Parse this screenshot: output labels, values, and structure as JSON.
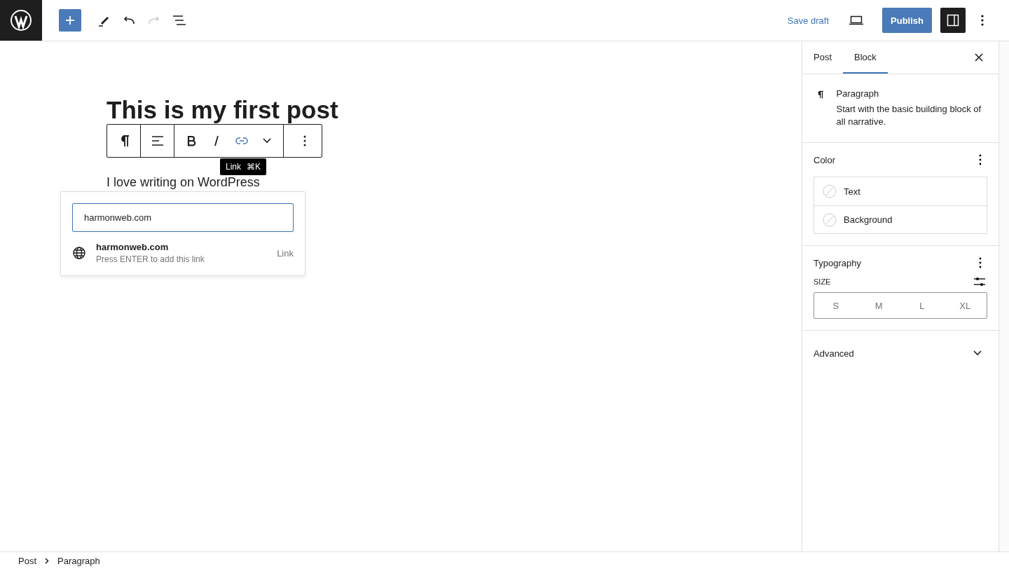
{
  "header": {
    "history": [
      {
        "kind": "undo",
        "disabled": false
      },
      {
        "kind": "redo",
        "disabled": true
      }
    ],
    "save_draft": "Save draft",
    "publish": "Publish",
    "settings_toggle": {
      "pressed": true
    }
  },
  "editor": {
    "title": "This is my first post",
    "paragraph": "I love writing on WordPress",
    "block_toolbar": [
      {
        "kind": "paragraph",
        "active": false
      },
      {
        "kind": "align",
        "active": false
      },
      {
        "kind": "bold",
        "active": false
      },
      {
        "kind": "italic",
        "active": false
      },
      {
        "kind": "link",
        "active": true
      },
      {
        "kind": "more",
        "active": false
      },
      {
        "kind": "options",
        "active": false
      }
    ],
    "tooltip": {
      "label": "Link",
      "shortcut": "⌘K"
    },
    "link_popover": {
      "value": "harmonweb.com",
      "suggestion": {
        "title": "harmonweb.com",
        "hint": "Press ENTER to add this link",
        "type": "Link"
      }
    }
  },
  "sidebar": {
    "tabs": [
      {
        "label": "Post",
        "selected": false
      },
      {
        "label": "Block",
        "selected": true
      }
    ],
    "block_card": {
      "title": "Paragraph",
      "description": "Start with the basic building block of all narrative."
    },
    "color": {
      "title": "Color",
      "items": [
        "Text",
        "Background"
      ]
    },
    "typography": {
      "title": "Typography",
      "size_label": "SIZE",
      "sizes": [
        {
          "label": "S",
          "selected": false
        },
        {
          "label": "M",
          "selected": false
        },
        {
          "label": "L",
          "selected": false
        },
        {
          "label": "XL",
          "selected": false
        }
      ]
    },
    "advanced": {
      "title": "Advanced",
      "expanded": false
    }
  },
  "breadcrumb": [
    "Post",
    "Paragraph"
  ]
}
